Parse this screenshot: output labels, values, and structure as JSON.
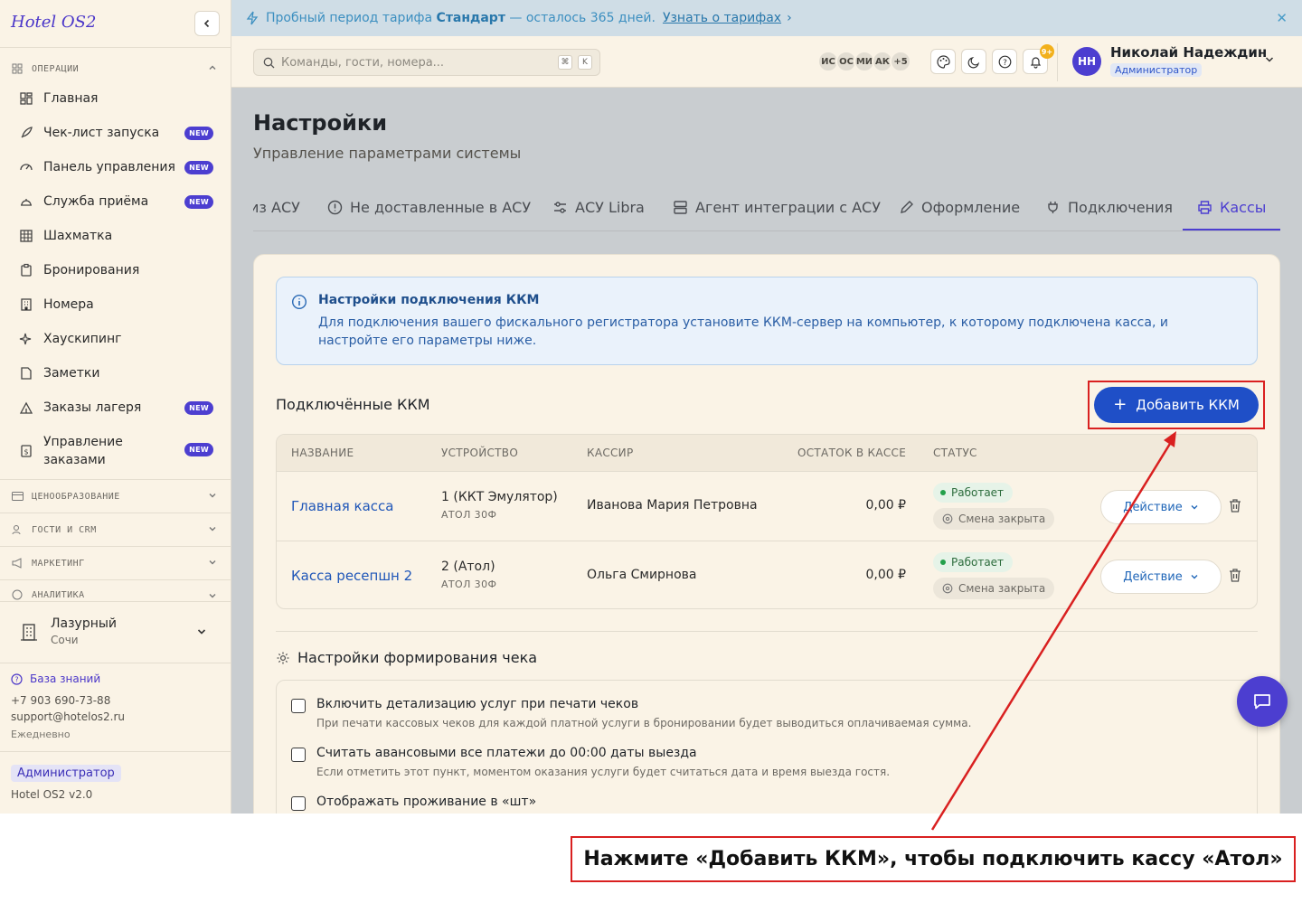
{
  "app": {
    "brand": "Hotel OS2",
    "version": "Hotel OS2 v2.0"
  },
  "banner": {
    "text_before": "Пробный период тарифа ",
    "plan": "Стандарт",
    "text_after": " — осталось 365 дней.",
    "link": "Узнать о тарифах",
    "link_arrow": "›",
    "close": "✕"
  },
  "sidebar": {
    "section_ops": "ОПЕРАЦИИ",
    "items": [
      {
        "label": "Главная",
        "icon": "dashboard-icon"
      },
      {
        "label": "Чек-лист запуска",
        "icon": "rocket-icon",
        "badge": "NEW"
      },
      {
        "label": "Панель управления",
        "icon": "gauge-icon",
        "badge": "NEW"
      },
      {
        "label": "Служба приёма",
        "icon": "bell-service-icon",
        "badge": "NEW"
      },
      {
        "label": "Шахматка",
        "icon": "grid-icon"
      },
      {
        "label": "Бронирования",
        "icon": "clipboard-icon"
      },
      {
        "label": "Номера",
        "icon": "building-icon"
      },
      {
        "label": "Хаускипинг",
        "icon": "sparkles-icon"
      },
      {
        "label": "Заметки",
        "icon": "note-icon"
      },
      {
        "label": "Заказы лагеря",
        "icon": "tent-icon",
        "badge": "NEW"
      },
      {
        "label_line1": "Управление",
        "label_line2": "заказами",
        "icon": "order-icon",
        "badge": "NEW"
      }
    ],
    "sections": [
      {
        "label": "ЦЕНООБРАЗОВАНИЕ",
        "icon": "card-icon"
      },
      {
        "label": "ГОСТИ И CRM",
        "icon": "users-icon"
      },
      {
        "label": "МАРКЕТИНГ",
        "icon": "megaphone-icon"
      },
      {
        "label": "АНАЛИТИКА",
        "icon": "chart-icon"
      }
    ],
    "hotel": {
      "name": "Лазурный",
      "city": "Сочи"
    },
    "knowledge_base": "База знаний",
    "phone": "+7 903 690-73-88",
    "email": "support@hotelos2.ru",
    "hours": "Ежедневно",
    "role": "Администратор"
  },
  "topbar": {
    "search_placeholder": "Команды, гости, номера...",
    "kbd1": "⌘",
    "kbd2": "K",
    "avatars": [
      "ИС",
      "ОС",
      "МИ",
      "АК",
      "+5"
    ],
    "notif_count": "9+",
    "user_initials": "НН",
    "user_name": "Николай Надеждин",
    "user_role": "Администратор"
  },
  "page": {
    "title": "Настройки",
    "subtitle": "Управление параметрами системы"
  },
  "tabs": [
    {
      "label": "из АСУ"
    },
    {
      "label": "Не доставленные в АСУ",
      "icon": "alert-circle-icon"
    },
    {
      "label": "АСУ Libra",
      "icon": "sliders-icon"
    },
    {
      "label": "Агент интеграции с АСУ",
      "icon": "server-icon"
    },
    {
      "label": "Оформление",
      "icon": "pencil-icon"
    },
    {
      "label": "Подключения",
      "icon": "plug-icon"
    },
    {
      "label": "Кассы",
      "icon": "printer-icon",
      "active": true
    }
  ],
  "info": {
    "title": "Настройки подключения ККМ",
    "text": "Для подключения вашего фискального регистратора установите ККМ-сервер на компьютер, к которому подключена касса, и настройте его параметры ниже."
  },
  "kkm": {
    "section_title": "Подключённые ККМ",
    "add_button": "Добавить ККМ",
    "columns": [
      "НАЗВАНИЕ",
      "УСТРОЙСТВО",
      "КАССИР",
      "ОСТАТОК В КАССЕ",
      "СТАТУС"
    ],
    "rows": [
      {
        "name": "Главная касса",
        "device": "1 (ККТ Эмулятор)",
        "model": "АТОЛ 30Ф",
        "cashier": "Иванова Мария Петровна",
        "balance": "0,00 ₽",
        "status": "Работает",
        "shift": "Смена закрыта",
        "action": "Действие"
      },
      {
        "name": "Касса ресепшн 2",
        "device": "2 (Атол)",
        "model": "АТОЛ 30Ф",
        "cashier": "Ольга Смирнова",
        "balance": "0,00 ₽",
        "status": "Работает",
        "shift": "Смена закрыта",
        "action": "Действие"
      }
    ]
  },
  "receipt": {
    "title": "Настройки формирования чека",
    "options": [
      {
        "label": "Включить детализацию услуг при печати чеков",
        "desc": "При печати кассовых чеков для каждой платной услуги в бронировании будет выводиться оплачиваемая сумма."
      },
      {
        "label": "Считать авансовыми все платежи до 00:00 даты выезда",
        "desc": "Если отметить этот пункт, моментом оказания услуги будет считаться дата и время выезда гостя."
      },
      {
        "label": "Отображать проживание в «шт»",
        "desc": ""
      }
    ]
  },
  "annotation": {
    "caption": "Нажмите «Добавить ККМ», чтобы подключить кассу «Атол»",
    "color": "#d92020"
  },
  "colors": {
    "accent": "#4c3ed0",
    "primary_button": "#1f4fc7",
    "sidebar_bg": "#faf3e6",
    "status_ok": "#23a04a"
  }
}
